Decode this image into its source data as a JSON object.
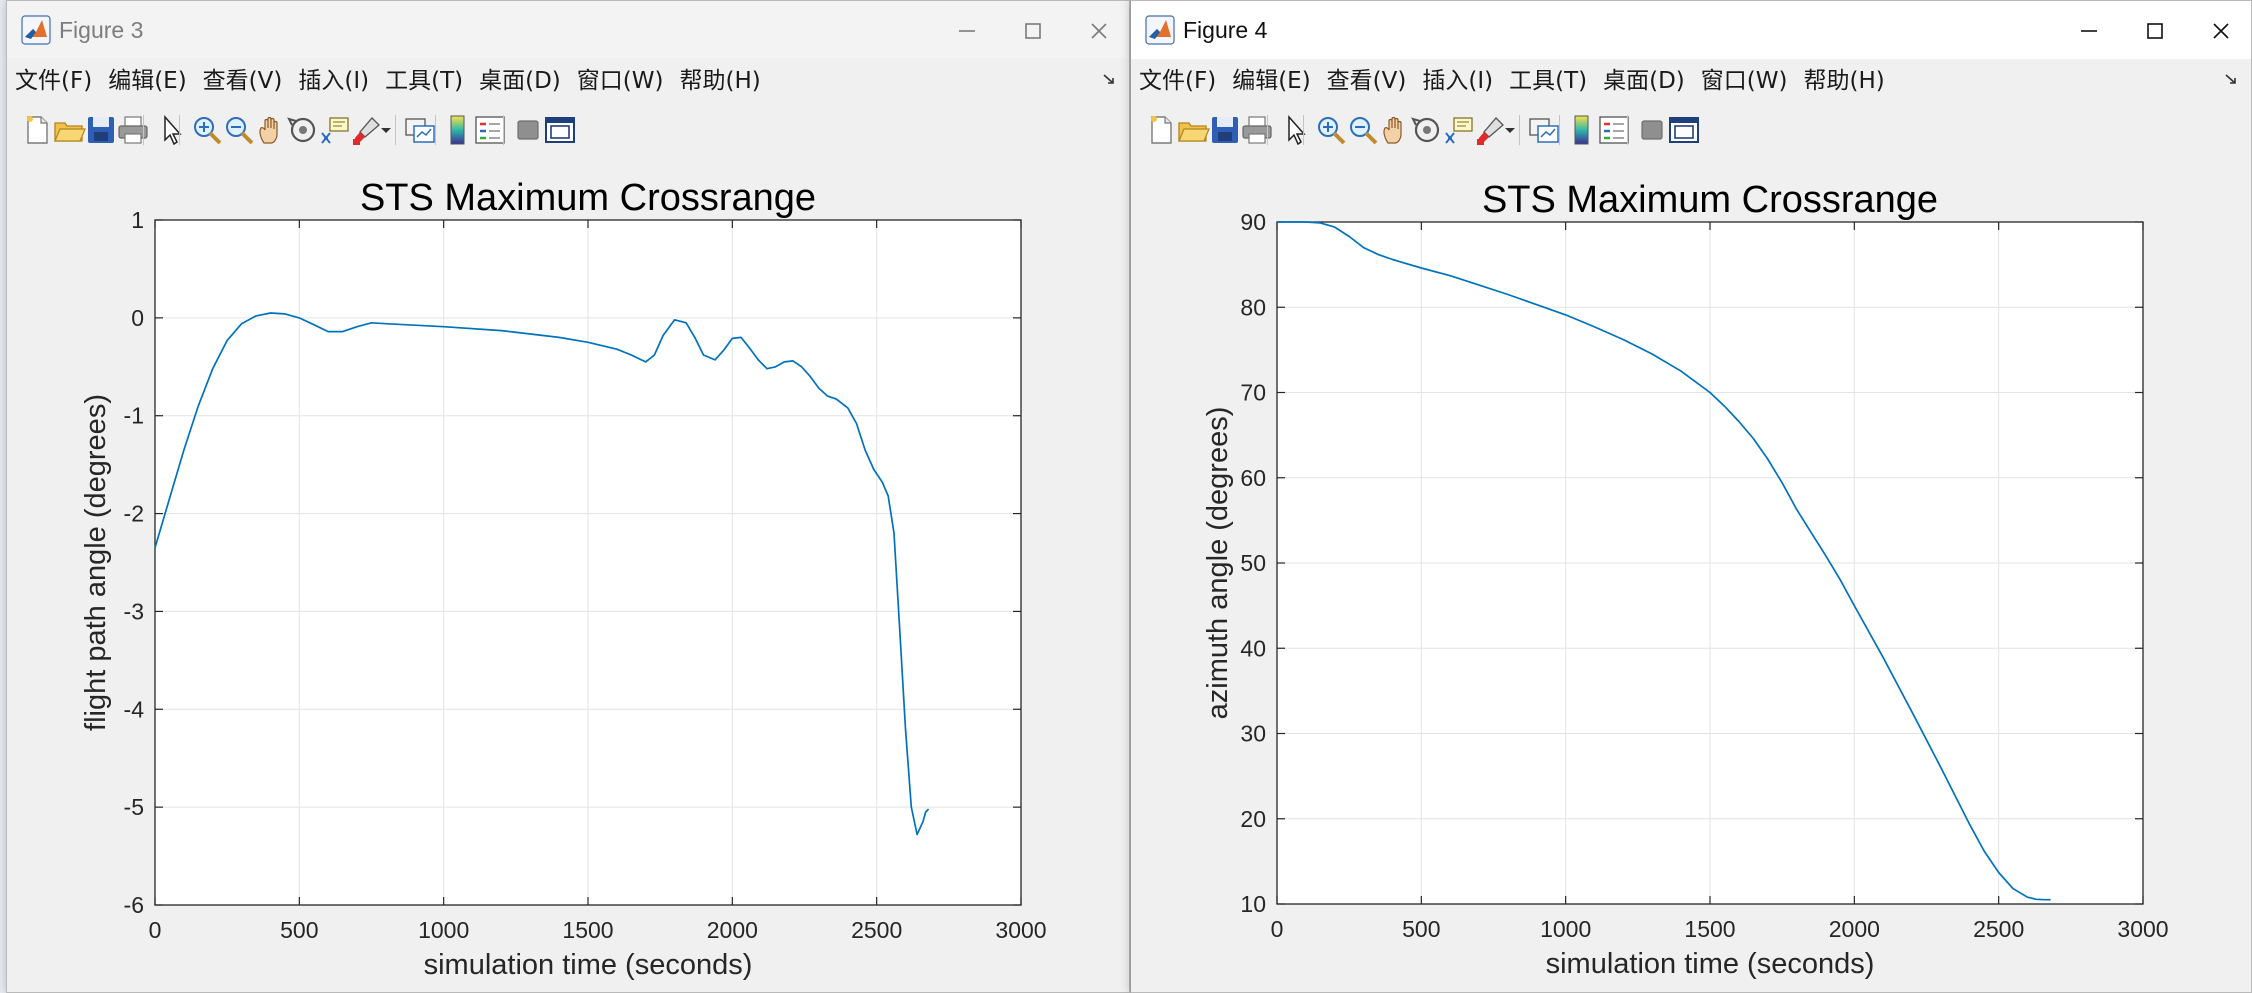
{
  "windows": [
    {
      "title": "Figure 3",
      "menu": [
        "文件(F)",
        "编辑(E)",
        "查看(V)",
        "插入(I)",
        "工具(T)",
        "桌面(D)",
        "窗口(W)",
        "帮助(H)"
      ],
      "chart_data": {
        "type": "line",
        "title": "STS Maximum Crossrange",
        "xlabel": "simulation time (seconds)",
        "ylabel": "flight path angle (degrees)",
        "xlim": [
          0,
          3000
        ],
        "ylim": [
          -6,
          1
        ],
        "xticks": [
          0,
          500,
          1000,
          1500,
          2000,
          2500,
          3000
        ],
        "yticks": [
          1,
          0,
          -1,
          -2,
          -3,
          -4,
          -5,
          -6
        ],
        "grid": true,
        "line_color": "#0072BD",
        "series": [
          {
            "x": [
              0,
              50,
              100,
              150,
              200,
              250,
              300,
              350,
              400,
              450,
              500,
              550,
              600,
              650,
              700,
              750,
              800,
              1000,
              1200,
              1400,
              1500,
              1600,
              1650,
              1700,
              1730,
              1760,
              1800,
              1840,
              1870,
              1900,
              1940,
              1970,
              2000,
              2030,
              2060,
              2090,
              2120,
              2150,
              2180,
              2210,
              2240,
              2270,
              2300,
              2330,
              2360,
              2400,
              2430,
              2460,
              2490,
              2520,
              2540,
              2560,
              2580,
              2600,
              2620,
              2640,
              2660,
              2670,
              2680
            ],
            "y": [
              -2.35,
              -1.85,
              -1.35,
              -0.9,
              -0.52,
              -0.23,
              -0.06,
              0.02,
              0.05,
              0.04,
              0.0,
              -0.07,
              -0.14,
              -0.14,
              -0.09,
              -0.05,
              -0.06,
              -0.09,
              -0.13,
              -0.2,
              -0.25,
              -0.32,
              -0.38,
              -0.45,
              -0.38,
              -0.18,
              -0.02,
              -0.05,
              -0.2,
              -0.38,
              -0.43,
              -0.33,
              -0.21,
              -0.2,
              -0.31,
              -0.43,
              -0.52,
              -0.5,
              -0.45,
              -0.44,
              -0.5,
              -0.6,
              -0.72,
              -0.8,
              -0.83,
              -0.92,
              -1.08,
              -1.35,
              -1.55,
              -1.68,
              -1.82,
              -2.2,
              -3.2,
              -4.2,
              -5.0,
              -5.28,
              -5.15,
              -5.05,
              -5.02
            ]
          }
        ]
      }
    },
    {
      "title": "Figure 4",
      "menu": [
        "文件(F)",
        "编辑(E)",
        "查看(V)",
        "插入(I)",
        "工具(T)",
        "桌面(D)",
        "窗口(W)",
        "帮助(H)"
      ],
      "chart_data": {
        "type": "line",
        "title": "STS Maximum Crossrange",
        "xlabel": "simulation time (seconds)",
        "ylabel": "azimuth angle (degrees)",
        "xlim": [
          0,
          3000
        ],
        "ylim": [
          10,
          90
        ],
        "xticks": [
          0,
          500,
          1000,
          1500,
          2000,
          2500,
          3000
        ],
        "yticks": [
          90,
          80,
          70,
          60,
          50,
          40,
          30,
          20,
          10
        ],
        "grid": true,
        "line_color": "#0072BD",
        "series": [
          {
            "x": [
              0,
              100,
              150,
              200,
              250,
              300,
              350,
              400,
              500,
              600,
              700,
              800,
              900,
              1000,
              1100,
              1200,
              1300,
              1400,
              1500,
              1550,
              1600,
              1650,
              1700,
              1750,
              1800,
              1850,
              1900,
              1950,
              2000,
              2100,
              2200,
              2300,
              2400,
              2450,
              2500,
              2550,
              2600,
              2630,
              2660,
              2680
            ],
            "y": [
              90,
              90,
              89.9,
              89.4,
              88.3,
              87.0,
              86.2,
              85.6,
              84.6,
              83.7,
              82.6,
              81.5,
              80.3,
              79.1,
              77.7,
              76.2,
              74.5,
              72.5,
              70.0,
              68.4,
              66.6,
              64.6,
              62.2,
              59.4,
              56.3,
              53.6,
              50.9,
              48.1,
              45.0,
              38.9,
              32.5,
              26.0,
              19.3,
              16.2,
              13.7,
              11.8,
              10.8,
              10.55,
              10.5,
              10.5
            ]
          }
        ]
      }
    }
  ]
}
